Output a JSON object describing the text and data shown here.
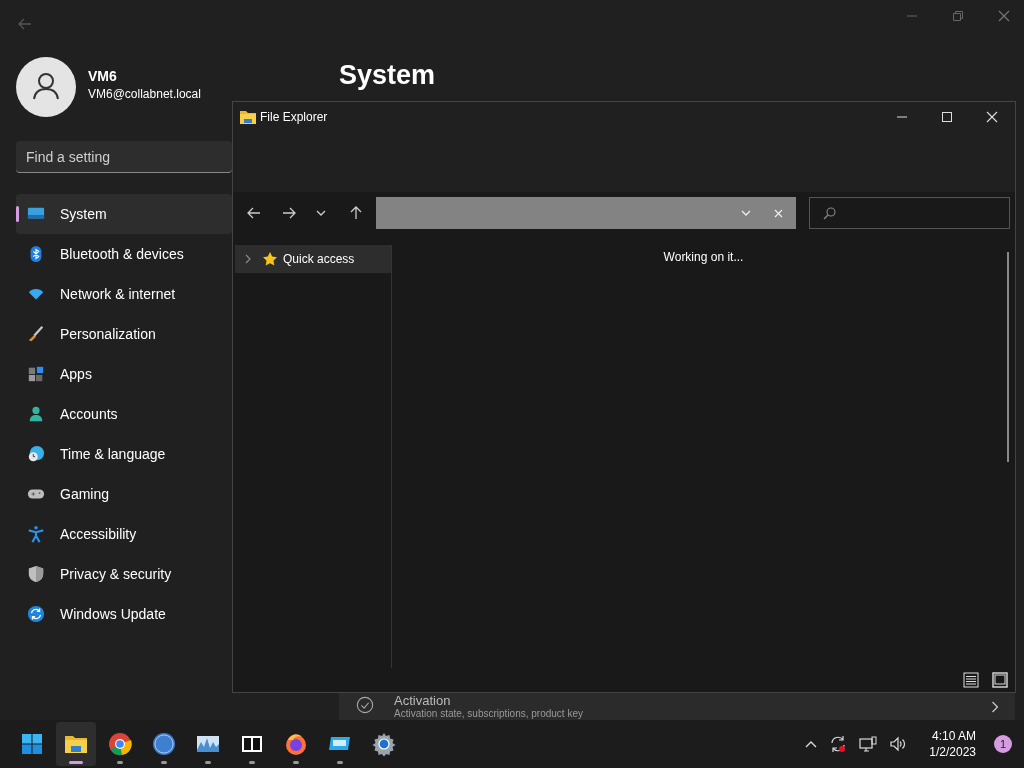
{
  "settings": {
    "user": {
      "name": "VM6",
      "email": "VM6@collabnet.local"
    },
    "search": {
      "placeholder": "Find a setting"
    },
    "nav": [
      {
        "label": "System",
        "kind": "system",
        "selected": true
      },
      {
        "label": "Bluetooth & devices",
        "kind": "bluetooth",
        "selected": false
      },
      {
        "label": "Network & internet",
        "kind": "network",
        "selected": false
      },
      {
        "label": "Personalization",
        "kind": "brush",
        "selected": false
      },
      {
        "label": "Apps",
        "kind": "apps",
        "selected": false
      },
      {
        "label": "Accounts",
        "kind": "accounts",
        "selected": false
      },
      {
        "label": "Time & language",
        "kind": "time",
        "selected": false
      },
      {
        "label": "Gaming",
        "kind": "gaming",
        "selected": false
      },
      {
        "label": "Accessibility",
        "kind": "accessibility",
        "selected": false
      },
      {
        "label": "Privacy & security",
        "kind": "shield",
        "selected": false
      },
      {
        "label": "Windows Update",
        "kind": "update",
        "selected": false
      }
    ],
    "page_title": "System",
    "activation": {
      "title": "Activation",
      "subtitle": "Activation state, subscriptions, product key"
    }
  },
  "explorer": {
    "title": "File Explorer",
    "tree": [
      {
        "label": "Quick access",
        "expanded": false,
        "selected": true
      }
    ],
    "status": "Working on it..."
  },
  "taskbar": {
    "apps": [
      {
        "kind": "start",
        "running": false,
        "active": false
      },
      {
        "kind": "explorer",
        "running": true,
        "active": true
      },
      {
        "kind": "chrome",
        "running": true,
        "active": false
      },
      {
        "kind": "qbittorrent",
        "running": true,
        "active": false
      },
      {
        "kind": "monitor",
        "running": true,
        "active": false
      },
      {
        "kind": "archiver",
        "running": true,
        "active": false
      },
      {
        "kind": "firefox",
        "running": true,
        "active": false
      },
      {
        "kind": "display",
        "running": true,
        "active": false
      },
      {
        "kind": "settings",
        "running": false,
        "active": false
      }
    ],
    "time": "4:10 AM",
    "date": "1/2/2023",
    "notification_count": "1"
  }
}
